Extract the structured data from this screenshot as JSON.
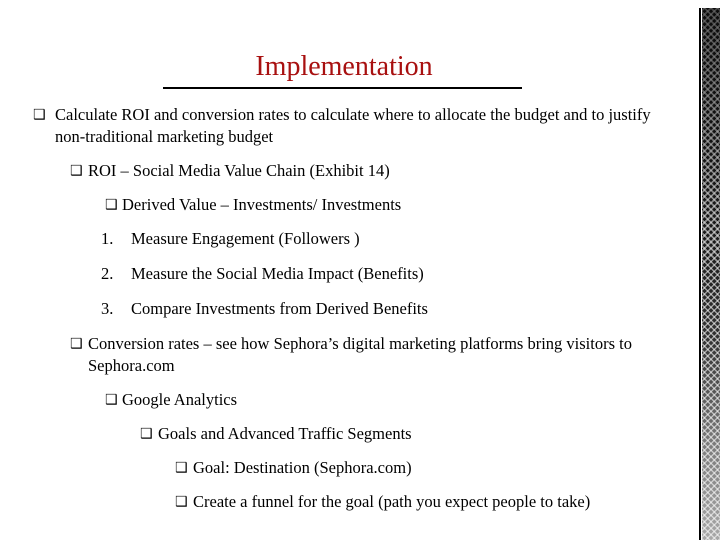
{
  "slide": {
    "title": "Implementation",
    "title_color": "#A81010",
    "rule_color": "#000000",
    "background_color": "#FFFFFF",
    "body_text_color": "#000000",
    "border_strip_color": "#1A1A1A",
    "bullet_glyph": "❑"
  },
  "body": {
    "items": [
      {
        "level": 1,
        "marker": "❑",
        "marker_type": "square-bullet",
        "text": "Calculate ROI and conversion rates to calculate where to allocate the budget and to justify non-traditional marketing budget"
      },
      {
        "level": 2,
        "marker": "❑",
        "marker_type": "square-bullet",
        "text": "ROI – Social Media Value Chain (Exhibit 14)"
      },
      {
        "level": 3,
        "marker": "❑",
        "marker_type": "square-bullet",
        "text": "Derived Value – Investments/ Investments"
      },
      {
        "level": 3,
        "marker": "1.",
        "marker_type": "number",
        "text": "Measure Engagement (Followers )"
      },
      {
        "level": 3,
        "marker": "2.",
        "marker_type": "number",
        "text": "Measure the Social Media Impact (Benefits)"
      },
      {
        "level": 3,
        "marker": "3.",
        "marker_type": "number",
        "text": "Compare Investments from Derived Benefits"
      },
      {
        "level": 2,
        "marker": "❑",
        "marker_type": "square-bullet",
        "text": "Conversion rates – see how Sephora’s digital marketing platforms bring visitors to Sephora.com"
      },
      {
        "level": 3,
        "marker": "❑",
        "marker_type": "square-bullet",
        "text": "Google Analytics"
      },
      {
        "level": 4,
        "marker": "❑",
        "marker_type": "square-bullet",
        "text": "Goals and Advanced Traffic Segments"
      },
      {
        "level": 5,
        "marker": "❑",
        "marker_type": "square-bullet",
        "text": "Goal:  Destination (Sephora.com)"
      },
      {
        "level": 5,
        "marker": "❑",
        "marker_type": "square-bullet",
        "text": "Create a funnel for the goal (path you expect people to take)"
      }
    ]
  }
}
